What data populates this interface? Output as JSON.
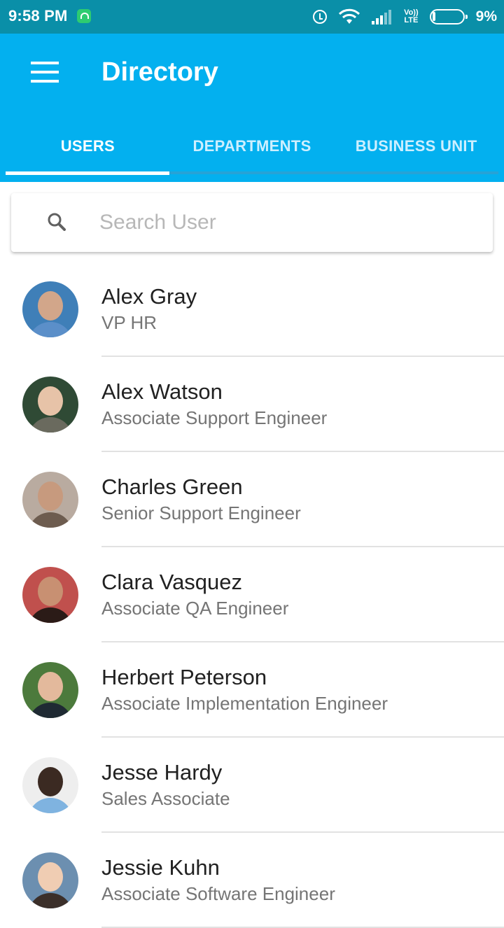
{
  "status_bar": {
    "time": "9:58 PM",
    "volte_line1": "Vo))",
    "volte_line2": "LTE",
    "battery_text": "9%",
    "battery_level": 0.09,
    "icons": [
      "notification-icon",
      "alarm-icon",
      "wifi-icon",
      "signal-icon",
      "volte-icon",
      "battery-icon"
    ]
  },
  "app_bar": {
    "title": "Directory",
    "menu_icon": "hamburger-menu-icon",
    "color": "#03b0ef"
  },
  "tabs": [
    {
      "label": "USERS",
      "active": true
    },
    {
      "label": "DEPARTMENTS",
      "active": false
    },
    {
      "label": "BUSINESS UNIT",
      "active": false
    }
  ],
  "search": {
    "placeholder": "Search User",
    "value": "",
    "icon": "search-icon"
  },
  "users": [
    {
      "name": "Alex Gray",
      "role": "VP HR",
      "avatar_bg": "#3f7fb8",
      "avatar_face": "#d2a68a",
      "avatar_body": "#5b8fc9"
    },
    {
      "name": "Alex Watson",
      "role": "Associate Support Engineer",
      "avatar_bg": "#2f4a35",
      "avatar_face": "#e7c3a8",
      "avatar_body": "#6a6a5e"
    },
    {
      "name": "Charles Green",
      "role": "Senior Support Engineer",
      "avatar_bg": "#b9aba0",
      "avatar_face": "#c79a7e",
      "avatar_body": "#6d5c4f"
    },
    {
      "name": "Clara Vasquez",
      "role": "Associate QA Engineer",
      "avatar_bg": "#c0504d",
      "avatar_face": "#c89072",
      "avatar_body": "#2b1b17"
    },
    {
      "name": "Herbert Peterson",
      "role": "Associate Implementation Engineer",
      "avatar_bg": "#4c7a3c",
      "avatar_face": "#e3b99c",
      "avatar_body": "#1f2a33"
    },
    {
      "name": "Jesse Hardy",
      "role": "Sales Associate",
      "avatar_bg": "#eeeeee",
      "avatar_face": "#3b2a22",
      "avatar_body": "#7fb3e0"
    },
    {
      "name": "Jessie Kuhn",
      "role": "Associate Software Engineer",
      "avatar_bg": "#6c8fb0",
      "avatar_face": "#f0cdb3",
      "avatar_body": "#3b2f2a"
    }
  ]
}
